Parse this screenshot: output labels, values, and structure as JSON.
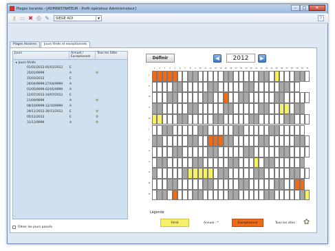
{
  "window": {
    "title": "Plages horaires - [ADMINISTRATEUR - Profil opérateur Administrateur]",
    "min": "–",
    "max": "□",
    "close": "✕"
  },
  "toolbar": {
    "site": "SIEGE ADI",
    "help": "?",
    "icons": [
      "key-icon",
      "new-icon",
      "delete-icon",
      "print-icon",
      "edit-icon"
    ]
  },
  "tabs": [
    "Plages Horaires",
    "Jours fériés et exceptionnels"
  ],
  "list": {
    "headers": [
      "Jours",
      "Annuel / Exceptionnel",
      "Tous les Sites"
    ],
    "group": "Jours fériés",
    "rows": [
      {
        "d": "01/01/2012-05/01/2012",
        "t": "E",
        "s": ""
      },
      {
        "d": "25/01/9999",
        "t": "A",
        "s": "✿"
      },
      {
        "d": "15/03/2012",
        "t": "E",
        "s": ""
      },
      {
        "d": "26/04/9999-27/04/9999",
        "t": "A",
        "s": ""
      },
      {
        "d": "01/05/9999-02/05/9999",
        "t": "A",
        "s": ""
      },
      {
        "d": "12/07/2012-14/07/2012",
        "t": "E",
        "s": ""
      },
      {
        "d": "21/09/9999",
        "t": "A",
        "s": "✿"
      },
      {
        "d": "08/10/9999-12/10/9999",
        "t": "A",
        "s": ""
      },
      {
        "d": "29/11/2012-30/11/2012",
        "t": "E",
        "s": "✿"
      },
      {
        "d": "05/12/2012",
        "t": "E",
        "s": "✿"
      },
      {
        "d": "31/12/9999",
        "t": "A",
        "s": "✿"
      }
    ],
    "filter": "Filtrer les jours passés"
  },
  "nav": {
    "define": "Définir",
    "prev": "◀",
    "next": "▶",
    "year": "2012"
  },
  "calendar": {
    "days": [
      "1",
      "2",
      "3",
      "4",
      "5",
      "6",
      "7",
      "8",
      "9",
      "10",
      "11",
      "12",
      "13",
      "14",
      "15",
      "16",
      "17",
      "18",
      "19",
      "20",
      "21",
      "22",
      "23",
      "24",
      "25",
      "26",
      "27",
      "28",
      "29",
      "30",
      "31"
    ],
    "months": [
      "J",
      "F",
      "M",
      "A",
      "M",
      "J",
      "J",
      "A",
      "S",
      "O",
      "N",
      "D"
    ],
    "startDow": [
      6,
      2,
      3,
      6,
      1,
      4,
      6,
      2,
      5,
      0,
      3,
      5
    ],
    "lengths": [
      31,
      29,
      31,
      30,
      31,
      30,
      31,
      31,
      30,
      31,
      30,
      31
    ],
    "highlights": {
      "0": {
        "1": "o",
        "2": "o",
        "3": "o",
        "4": "o",
        "5": "o",
        "25": "y"
      },
      "2": {
        "15": "o"
      },
      "3": {
        "26": "y",
        "27": "y"
      },
      "4": {
        "1": "y",
        "2": "y"
      },
      "6": {
        "12": "o",
        "13": "o",
        "14": "o"
      },
      "8": {
        "21": "y"
      },
      "9": {
        "8": "y",
        "9": "y",
        "10": "y",
        "11": "y",
        "12": "y"
      },
      "10": {
        "29": "o",
        "30": "o"
      },
      "11": {
        "5": "o",
        "31": "y"
      }
    }
  },
  "legend": {
    "title": "Légende",
    "ferie": "Férié",
    "annuel": "Annuel : *",
    "exceptionnel": "Exceptionnel",
    "tous": "Tous les sites :"
  }
}
